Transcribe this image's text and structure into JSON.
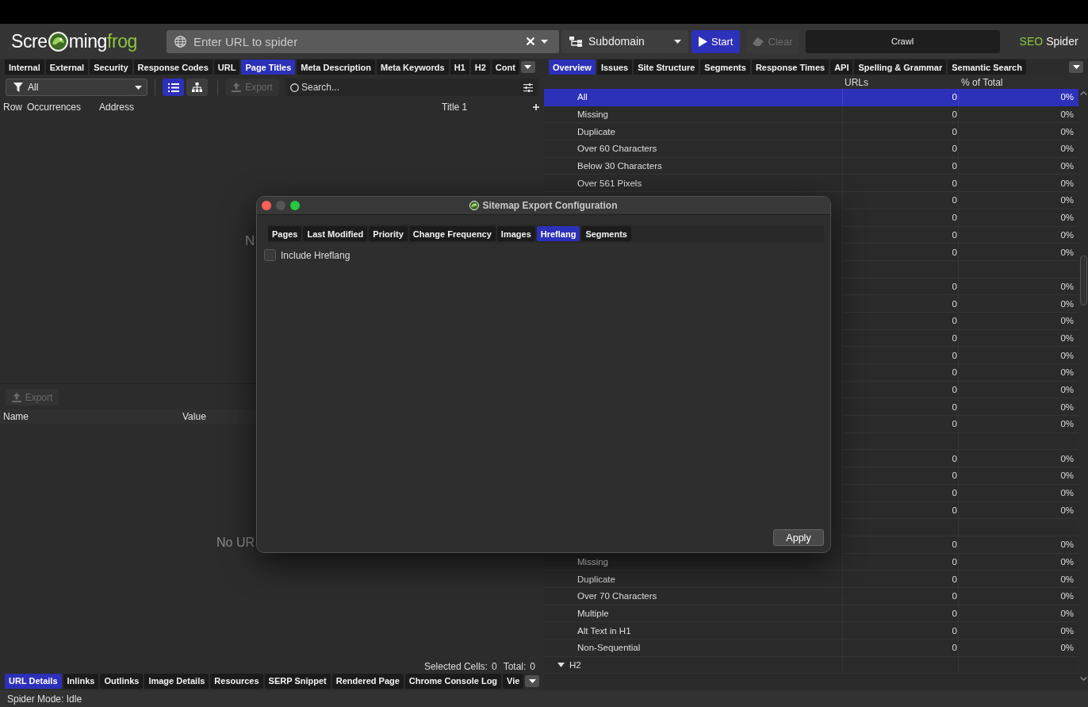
{
  "toolbar": {
    "logo": {
      "start": "Scre",
      "middle": "ming",
      "end": "frog"
    },
    "url_field": {
      "placeholder": "Enter URL to spider"
    },
    "mode_dropdown": {
      "value": "Subdomain"
    },
    "start_button": {
      "label": "Start",
      "disabled": false
    },
    "clear_button": {
      "label": "Clear",
      "disabled": true
    },
    "crawl_status": {
      "label": "Crawl"
    },
    "product": {
      "accent": "SEO",
      "name": "Spider"
    }
  },
  "left_panel": {
    "tabs": [
      {
        "label": "Internal",
        "selected": false
      },
      {
        "label": "External",
        "selected": false
      },
      {
        "label": "Security",
        "selected": false
      },
      {
        "label": "Response Codes",
        "selected": false
      },
      {
        "label": "URL",
        "selected": false
      },
      {
        "label": "Page Titles",
        "selected": true
      },
      {
        "label": "Meta Description",
        "selected": false
      },
      {
        "label": "Meta Keywords",
        "selected": false
      },
      {
        "label": "H1",
        "selected": false
      },
      {
        "label": "H2",
        "selected": false
      },
      {
        "label": "Cont",
        "selected": false
      }
    ],
    "filter": {
      "value": "All"
    },
    "view_toggle": [
      {
        "selected": true
      },
      {
        "selected": false
      }
    ],
    "export_button": {
      "label": "Export",
      "disabled": true
    },
    "search": {
      "placeholder": "Search..."
    },
    "columns": [
      "Row",
      "Occurrences",
      "Address",
      "Title 1"
    ],
    "empty_message": "N",
    "details": {
      "export_button": {
        "label": "Export",
        "disabled": true
      },
      "columns": [
        "Name",
        "Value"
      ],
      "empty_message": "No UR",
      "summary": {
        "selected_label": "Selected Cells:",
        "selected_value": "0",
        "total_label": "Total:",
        "total_value": "0"
      }
    },
    "bottom_tabs": [
      {
        "label": "URL Details",
        "selected": true
      },
      {
        "label": "Inlinks",
        "selected": false
      },
      {
        "label": "Outlinks",
        "selected": false
      },
      {
        "label": "Image Details",
        "selected": false
      },
      {
        "label": "Resources",
        "selected": false
      },
      {
        "label": "SERP Snippet",
        "selected": false
      },
      {
        "label": "Rendered Page",
        "selected": false
      },
      {
        "label": "Chrome Console Log",
        "selected": false
      },
      {
        "label": "Vie",
        "selected": false
      }
    ]
  },
  "right_panel": {
    "tabs": [
      {
        "label": "Overview",
        "selected": true
      },
      {
        "label": "Issues",
        "selected": false
      },
      {
        "label": "Site Structure",
        "selected": false
      },
      {
        "label": "Segments",
        "selected": false
      },
      {
        "label": "Response Times",
        "selected": false
      },
      {
        "label": "API",
        "selected": false
      },
      {
        "label": "Spelling & Grammar",
        "selected": false
      },
      {
        "label": "Semantic Search",
        "selected": false
      }
    ],
    "columns": [
      "URLs",
      "% of Total"
    ],
    "rows": [
      {
        "kind": "item",
        "label": "All",
        "urls": "0",
        "percent": "0%",
        "selected": true
      },
      {
        "kind": "item",
        "label": "Missing",
        "urls": "0",
        "percent": "0%",
        "selected": false
      },
      {
        "kind": "item",
        "label": "Duplicate",
        "urls": "0",
        "percent": "0%",
        "selected": false
      },
      {
        "kind": "item",
        "label": "Over 60 Characters",
        "urls": "0",
        "percent": "0%",
        "selected": false
      },
      {
        "kind": "item",
        "label": "Below 30 Characters",
        "urls": "0",
        "percent": "0%",
        "selected": false
      },
      {
        "kind": "item",
        "label": "Over 561 Pixels",
        "urls": "0",
        "percent": "0%",
        "selected": false
      },
      {
        "kind": "item",
        "urls": "0",
        "percent": "0%",
        "selected": false
      },
      {
        "kind": "item",
        "urls": "0",
        "percent": "0%",
        "selected": false
      },
      {
        "kind": "item",
        "urls": "0",
        "percent": "0%",
        "selected": false
      },
      {
        "kind": "item",
        "urls": "0",
        "percent": "0%",
        "selected": false
      },
      {
        "kind": "group",
        "selected": false
      },
      {
        "kind": "item",
        "urls": "0",
        "percent": "0%",
        "selected": false
      },
      {
        "kind": "item",
        "urls": "0",
        "percent": "0%",
        "selected": false
      },
      {
        "kind": "item",
        "urls": "0",
        "percent": "0%",
        "selected": false
      },
      {
        "kind": "item",
        "urls": "0",
        "percent": "0%",
        "selected": false
      },
      {
        "kind": "item",
        "urls": "0",
        "percent": "0%",
        "selected": false
      },
      {
        "kind": "item",
        "urls": "0",
        "percent": "0%",
        "selected": false
      },
      {
        "kind": "item",
        "urls": "0",
        "percent": "0%",
        "selected": false
      },
      {
        "kind": "item",
        "urls": "0",
        "percent": "0%",
        "selected": false
      },
      {
        "kind": "item",
        "urls": "0",
        "percent": "0%",
        "selected": false
      },
      {
        "kind": "group",
        "selected": false
      },
      {
        "kind": "item",
        "urls": "0",
        "percent": "0%",
        "selected": false
      },
      {
        "kind": "item",
        "urls": "0",
        "percent": "0%",
        "selected": false
      },
      {
        "kind": "item",
        "urls": "0",
        "percent": "0%",
        "selected": false
      },
      {
        "kind": "item",
        "urls": "0",
        "percent": "0%",
        "selected": false
      },
      {
        "kind": "group",
        "selected": false
      },
      {
        "kind": "item",
        "urls": "0",
        "percent": "0%",
        "selected": false
      },
      {
        "kind": "item",
        "label": "Missing",
        "urls": "0",
        "percent": "0%",
        "selected": false
      },
      {
        "kind": "item",
        "label": "Duplicate",
        "urls": "0",
        "percent": "0%",
        "selected": false
      },
      {
        "kind": "item",
        "label": "Over 70 Characters",
        "urls": "0",
        "percent": "0%",
        "selected": false
      },
      {
        "kind": "item",
        "label": "Multiple",
        "urls": "0",
        "percent": "0%",
        "selected": false
      },
      {
        "kind": "item",
        "label": "Alt Text in H1",
        "urls": "0",
        "percent": "0%",
        "selected": false
      },
      {
        "kind": "item",
        "label": "Non-Sequential",
        "urls": "0",
        "percent": "0%",
        "selected": false
      },
      {
        "kind": "group",
        "label": "H2",
        "expanded": true,
        "selected": false
      }
    ]
  },
  "dialog": {
    "title": "Sitemap Export Configuration",
    "window_controls": [
      {
        "kind": "close",
        "disabled": false
      },
      {
        "kind": "minimize",
        "disabled": true
      },
      {
        "kind": "zoom",
        "disabled": false
      }
    ],
    "tabs": [
      {
        "label": "Pages",
        "selected": false
      },
      {
        "label": "Last Modified",
        "selected": false
      },
      {
        "label": "Priority",
        "selected": false
      },
      {
        "label": "Change Frequency",
        "selected": false
      },
      {
        "label": "Images",
        "selected": false
      },
      {
        "label": "Hreflang",
        "selected": true
      },
      {
        "label": "Segments",
        "selected": false
      }
    ],
    "options": [
      {
        "label": "Include Hreflang",
        "checked": false
      }
    ],
    "apply_button": {
      "label": "Apply"
    }
  },
  "status_bar": {
    "text": "Spider Mode: Idle"
  }
}
